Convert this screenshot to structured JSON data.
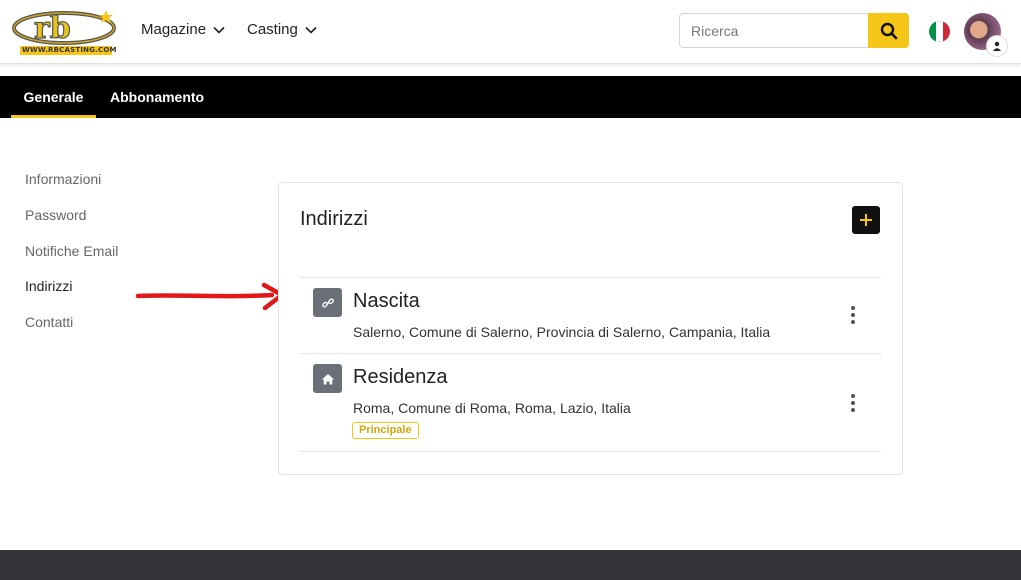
{
  "header": {
    "logo_text": "www.rbcasting.com",
    "nav": [
      {
        "label": "Magazine"
      },
      {
        "label": "Casting"
      }
    ],
    "search": {
      "placeholder": "Ricerca",
      "value": ""
    },
    "flag_colors": [
      "#009246",
      "#ffffff",
      "#ce2b37"
    ],
    "accent": "#f5c518"
  },
  "tabs": [
    {
      "label": "Generale",
      "active": true
    },
    {
      "label": "Abbonamento",
      "active": false
    }
  ],
  "sidebar": {
    "items": [
      {
        "label": "Informazioni"
      },
      {
        "label": "Password"
      },
      {
        "label": "Notifiche Email"
      },
      {
        "label": "Indirizzi",
        "active": true
      },
      {
        "label": "Contatti"
      }
    ]
  },
  "addresses": {
    "title": "Indirizzi",
    "items": [
      {
        "name": "Nascita",
        "detail": "Salerno, Comune di Salerno, Provincia di Salerno, Campania, Italia",
        "icon": "link-icon"
      },
      {
        "name": "Residenza",
        "detail": "Roma, Comune di Roma, Roma, Lazio, Italia",
        "icon": "home-icon",
        "badge": "Principale"
      }
    ]
  }
}
